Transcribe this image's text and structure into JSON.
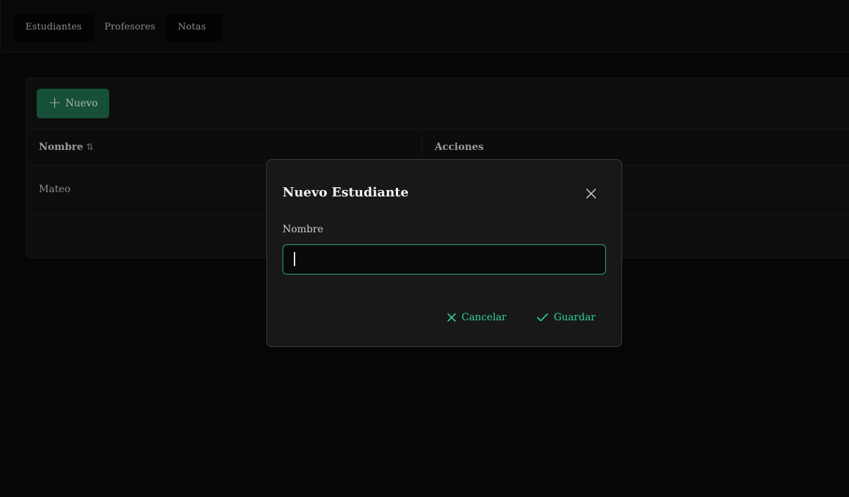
{
  "menubar": {
    "items": [
      {
        "label": "Estudiantes"
      },
      {
        "label": "Profesores"
      },
      {
        "label": "Notas"
      }
    ]
  },
  "toolbar": {
    "new_label": "Nuevo",
    "new_icon": "plus-icon"
  },
  "table": {
    "columns": [
      {
        "label": "Nombre",
        "sortable": true
      },
      {
        "label": "Acciones"
      }
    ],
    "rows": [
      {
        "nombre": "Mateo"
      }
    ]
  },
  "dialog": {
    "title": "Nuevo Estudiante",
    "close_icon": "close-icon",
    "field_label": "Nombre",
    "field_value": "",
    "cancel_label": "Cancelar",
    "save_label": "Guardar"
  },
  "colors": {
    "accent": "#34d399",
    "primary_button": "#1f6b4c",
    "background": "#090909",
    "dialog_bg": "#18181b"
  }
}
